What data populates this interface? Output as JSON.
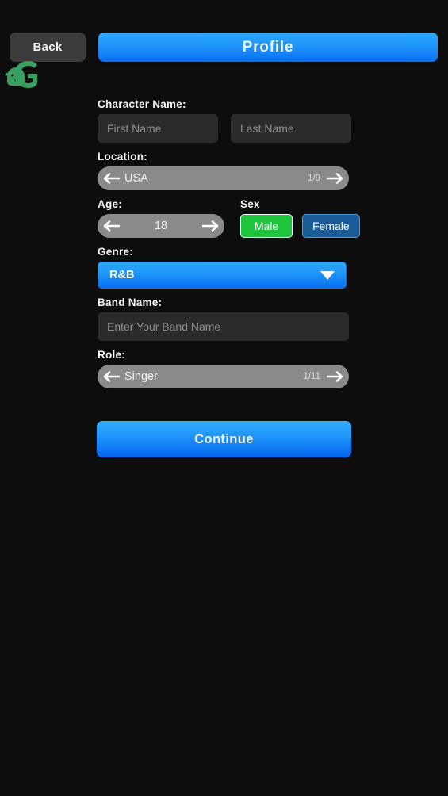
{
  "screen": {
    "title": "Profile",
    "background_color": "#0d0d0d"
  },
  "nav": {
    "back_label": "Back",
    "logo_icon": "green-g-logo-icon"
  },
  "theme": {
    "accent_blue": "#1f95fa",
    "accent_blue_dark": "#0a6ff0",
    "selected_green": "#1fc63d",
    "unselected_blue": "#1b5b96",
    "pill_gray": "#8a8a8a",
    "input_gray": "#2b2b2b",
    "title_text": "#e9f4ff"
  },
  "form": {
    "character_name": {
      "label": "Character Name:",
      "first": {
        "value": "",
        "placeholder": "First Name"
      },
      "last": {
        "value": "",
        "placeholder": "Last Name"
      }
    },
    "location": {
      "label": "Location:",
      "value": "USA",
      "count": "1/9",
      "prev_icon": "arrow-left-icon",
      "next_icon": "arrow-right-icon"
    },
    "age": {
      "label": "Age:",
      "value": "18",
      "prev_icon": "arrow-left-icon",
      "next_icon": "arrow-right-icon"
    },
    "sex": {
      "label": "Sex",
      "options": [
        {
          "label": "Male",
          "selected": true
        },
        {
          "label": "Female",
          "selected": false
        }
      ]
    },
    "genre": {
      "label": "Genre:",
      "value": "R&B",
      "caret_icon": "chevron-down-icon"
    },
    "band_name": {
      "label": "Band Name:",
      "value": "",
      "placeholder": "Enter Your Band Name"
    },
    "role": {
      "label": "Role:",
      "value": "Singer",
      "count": "1/11",
      "prev_icon": "arrow-left-icon",
      "next_icon": "arrow-right-icon"
    }
  },
  "actions": {
    "continue_label": "Continue"
  }
}
